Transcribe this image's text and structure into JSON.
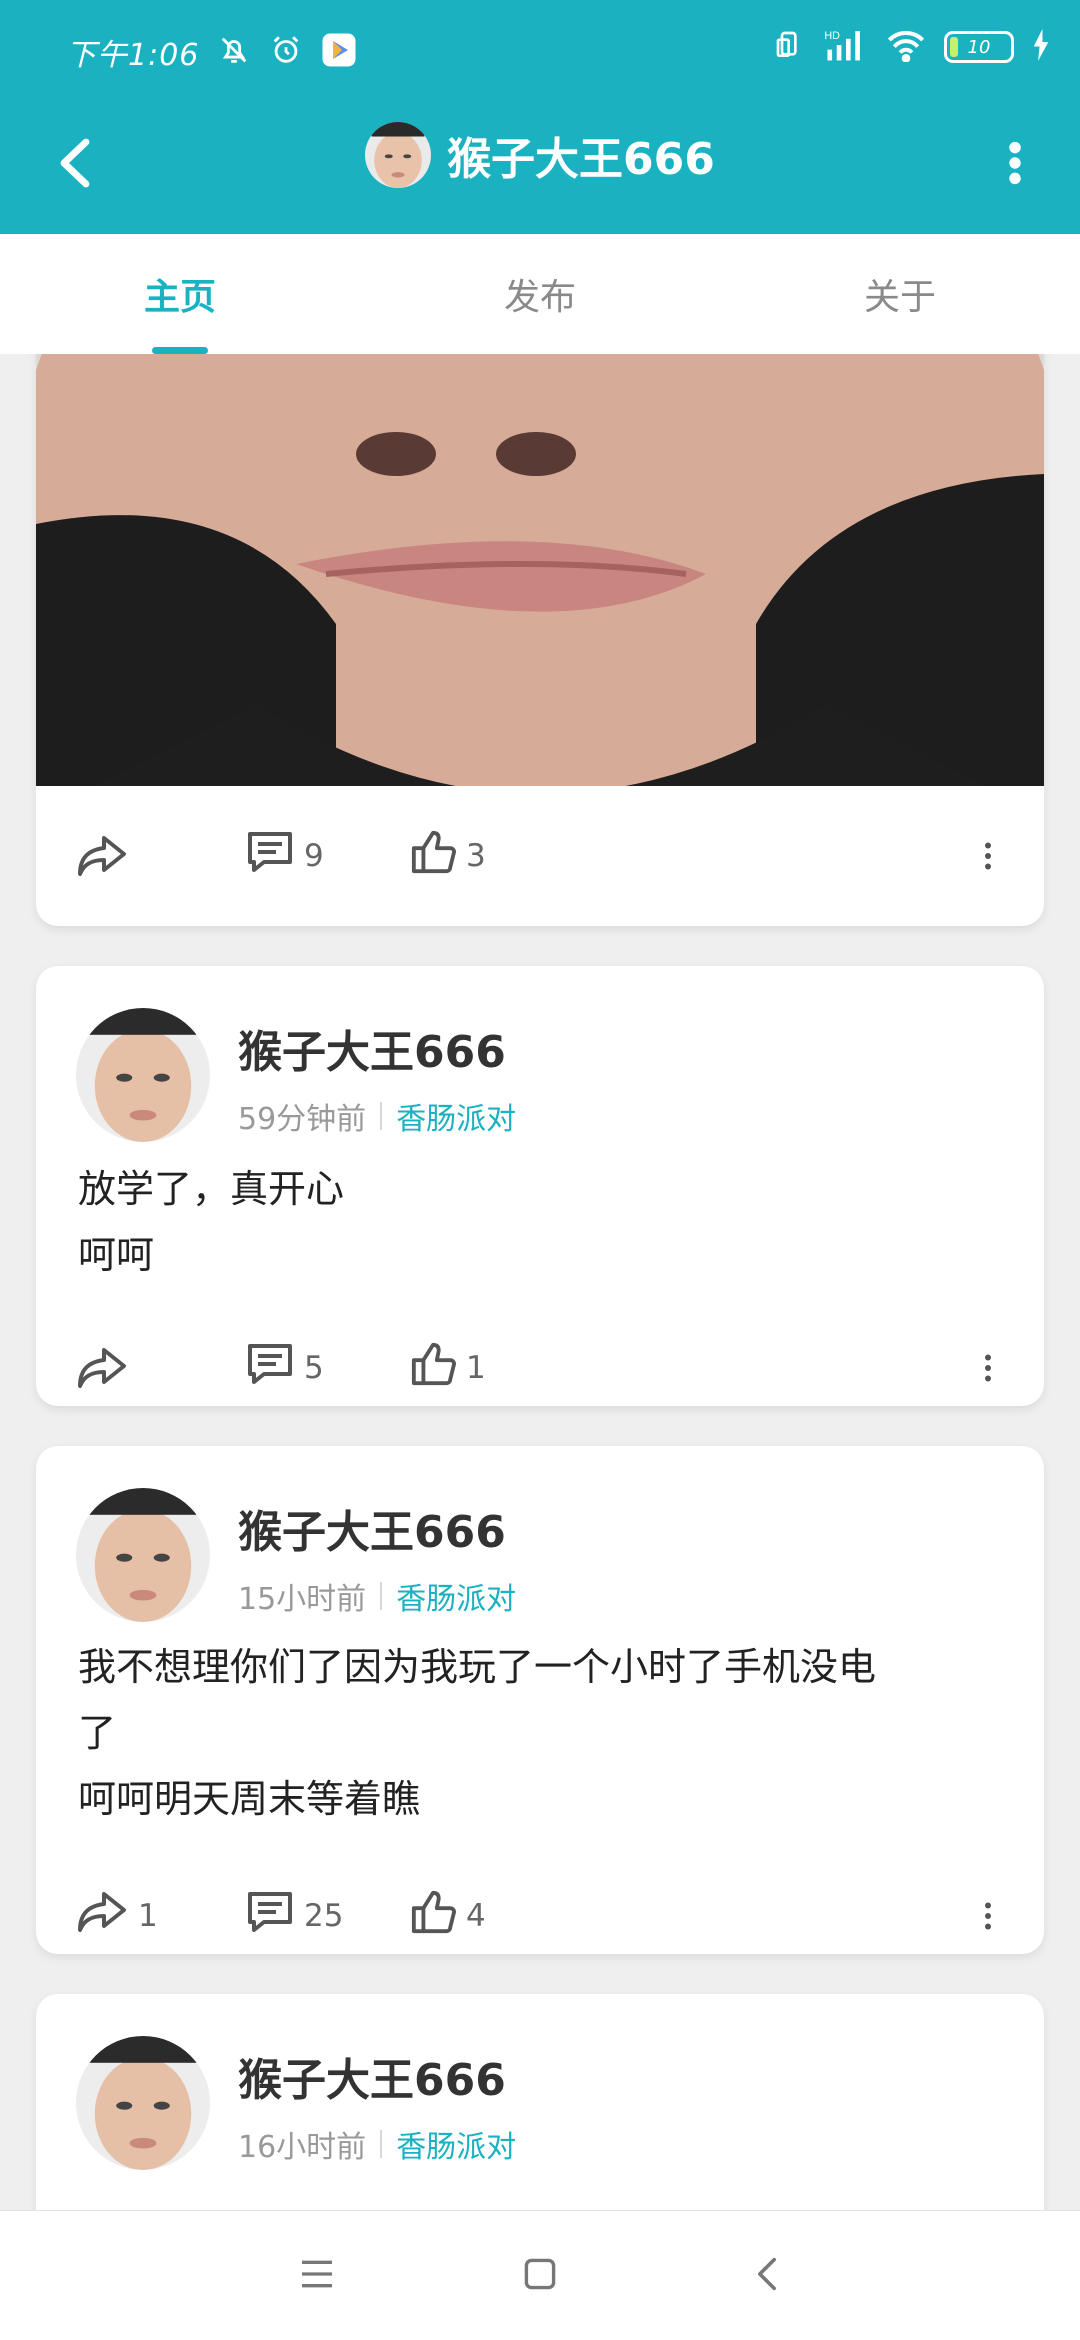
{
  "status_bar": {
    "time": "下午1:06",
    "battery_level": "10",
    "icons": [
      "mute-bell-icon",
      "alarm-icon",
      "play-store-icon",
      "vibrate-icon",
      "signal-icon",
      "wifi-icon",
      "battery-icon",
      "charging-icon"
    ],
    "network_label": "HD"
  },
  "header": {
    "title": "猴子大王666",
    "back_icon": "chevron-left-icon",
    "more_icon": "more-vertical-icon",
    "bg_color": "#1ab2c1"
  },
  "tabs": [
    {
      "label": "主页",
      "active": true
    },
    {
      "label": "发布",
      "active": false
    },
    {
      "label": "关于",
      "active": false
    }
  ],
  "posts": [
    {
      "partial_top": true,
      "share_count": "",
      "comment_count": "9",
      "like_count": "3"
    },
    {
      "author": "猴子大王666",
      "time": "59分钟前",
      "topic": "香肠派对",
      "text_lines": [
        "放学了，真开心",
        "呵呵"
      ],
      "share_count": "",
      "comment_count": "5",
      "like_count": "1"
    },
    {
      "author": "猴子大王666",
      "time": "15小时前",
      "topic": "香肠派对",
      "text_lines": [
        "我不想理你们了因为我玩了一个小时了手机没电",
        "了",
        "呵呵明天周末等着瞧"
      ],
      "share_count": "1",
      "comment_count": "25",
      "like_count": "4"
    },
    {
      "author": "猴子大王666",
      "time": "16小时前",
      "topic": "香肠派对"
    }
  ],
  "nav_bar": {
    "icons": [
      "menu-icon",
      "home-square-icon",
      "back-triangle-icon"
    ]
  },
  "accent_color": "#1ab2c1"
}
